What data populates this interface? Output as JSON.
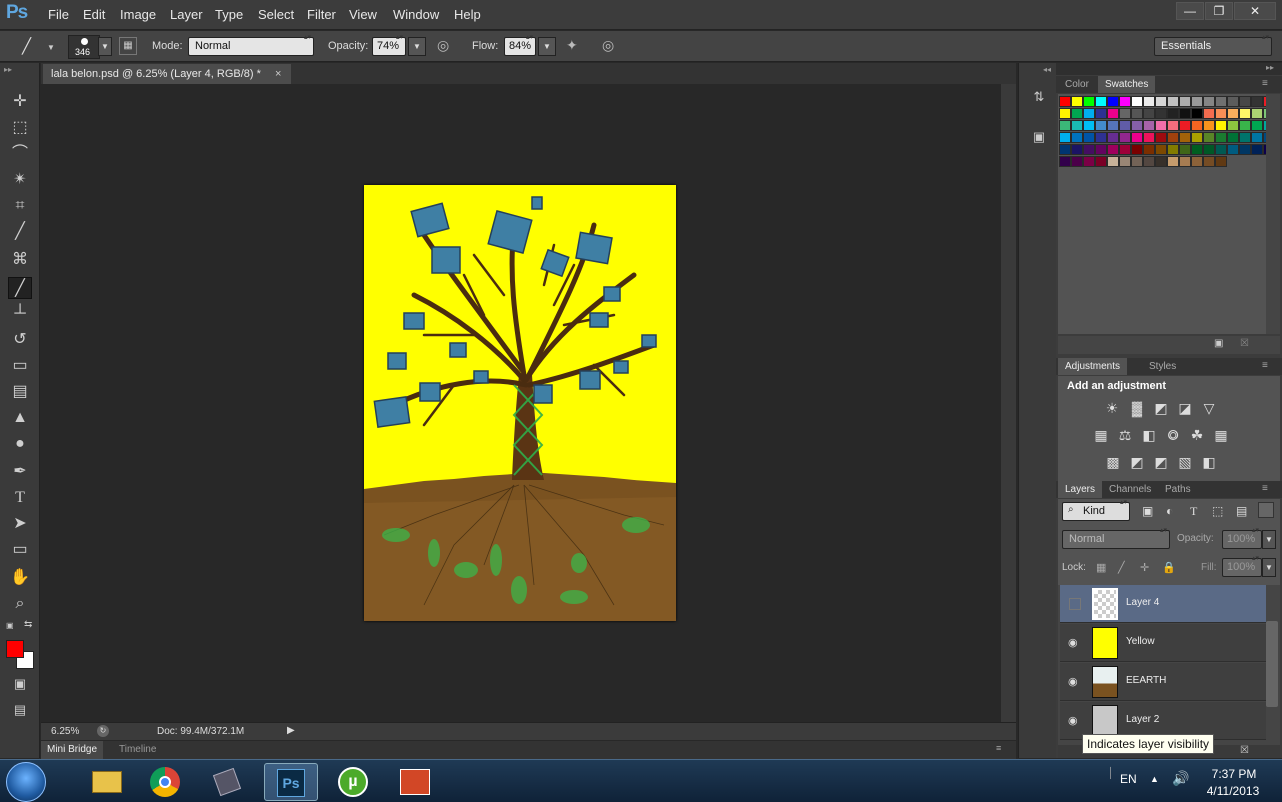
{
  "app": {
    "logo": "Ps",
    "colors": {
      "accent": "#5fa7e0",
      "selected_layer": "#5a6a86",
      "foreground": "#ff0000",
      "background": "#ffffff"
    }
  },
  "menu": [
    "File",
    "Edit",
    "Image",
    "Layer",
    "Type",
    "Select",
    "Filter",
    "View",
    "Window",
    "Help"
  ],
  "window_buttons": {
    "minimize": "—",
    "restore": "❐",
    "close": "✕"
  },
  "options": {
    "brush_size": "346",
    "mode_label": "Mode:",
    "mode_value": "Normal",
    "opacity_label": "Opacity:",
    "opacity_value": "74%",
    "flow_label": "Flow:",
    "flow_value": "84%",
    "workspace": "Essentials"
  },
  "document": {
    "tab_title": "lala belon.psd @ 6.25% (Layer 4, RGB/8) *",
    "close": "×"
  },
  "status": {
    "zoom": "6.25%",
    "doc": "Doc: 99.4M/372.1M"
  },
  "bottom_tabs": [
    "Mini Bridge",
    "Timeline"
  ],
  "color_panel": {
    "tabs": [
      "Color",
      "Swatches"
    ]
  },
  "adjustments": {
    "tabs": [
      "Adjustments",
      "Styles"
    ],
    "heading": "Add an adjustment"
  },
  "layers_panel": {
    "tabs": [
      "Layers",
      "Channels",
      "Paths"
    ],
    "filter": "Kind",
    "blend": "Normal",
    "opacity_label": "Opacity:",
    "opacity_value": "100%",
    "lock_label": "Lock:",
    "fill_label": "Fill:",
    "fill_value": "100%",
    "layers": [
      {
        "name": "Layer 4",
        "visible": false,
        "selected": true
      },
      {
        "name": "Yellow",
        "visible": true,
        "selected": false
      },
      {
        "name": "EEARTH",
        "visible": true,
        "selected": false
      },
      {
        "name": "Layer 2",
        "visible": true,
        "selected": false
      }
    ]
  },
  "tooltip": "Indicates layer visibility",
  "taskbar": {
    "language": "EN",
    "time": "7:37 PM",
    "date": "4/11/2013",
    "apps": [
      "start-orb",
      "explorer-icon",
      "chrome-icon",
      "media-icon",
      "photoshop-icon",
      "utorrent-icon",
      "presentation-icon"
    ],
    "ps_label": "Ps"
  }
}
